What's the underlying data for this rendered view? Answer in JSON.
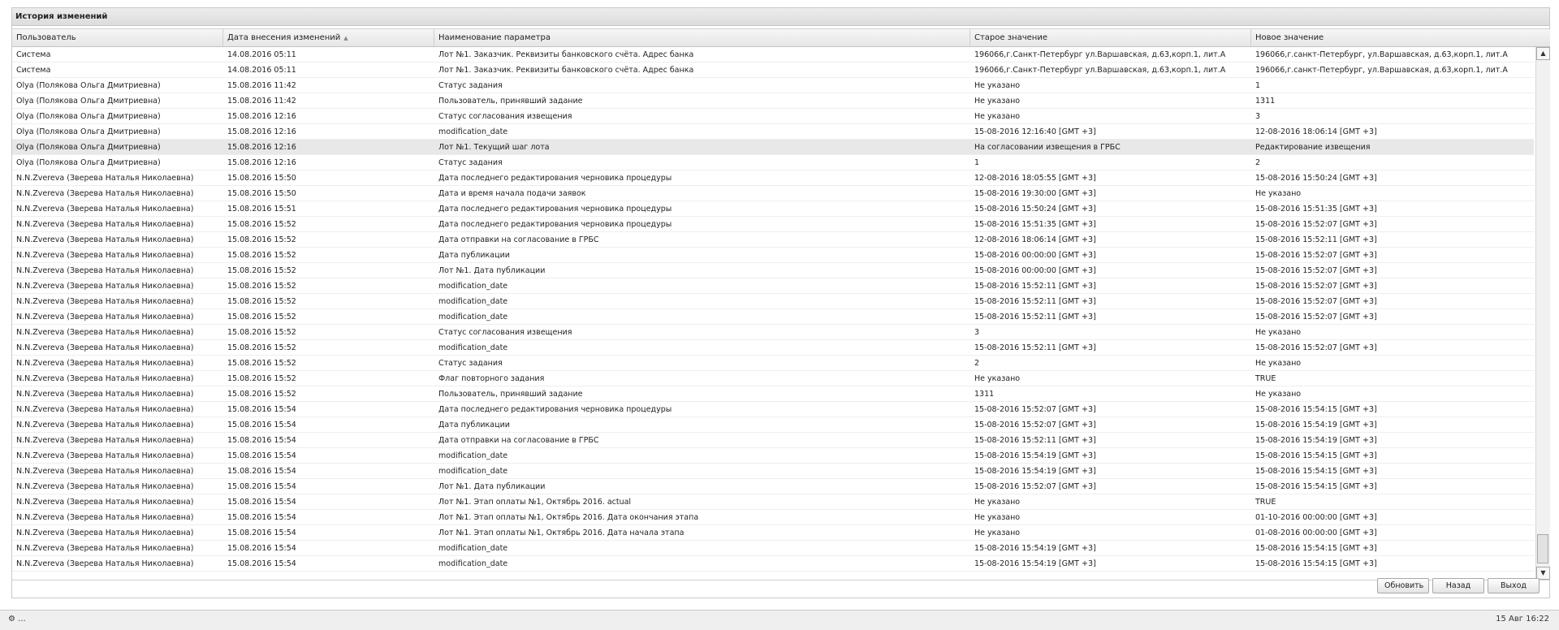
{
  "window": {
    "title": "История изменений"
  },
  "columns": [
    "Пользователь",
    "Дата внесения изменений",
    "Наименование параметра",
    "Старое значение",
    "Новое значение"
  ],
  "rows": [
    [
      "Система",
      "14.08.2016 05:11",
      "Лот №1. Заказчик. Реквизиты банковского счёта. Адрес банка",
      "196066,г.Санкт-Петербург ул.Варшавская, д.63,корп.1, лит.А",
      "196066,г.санкт-Петербург, ул.Варшавская, д.63,корп.1, лит.А"
    ],
    [
      "Система",
      "14.08.2016 05:11",
      "Лот №1. Заказчик. Реквизиты банковского счёта. Адрес банка",
      "196066,г.Санкт-Петербург ул.Варшавская, д.63,корп.1, лит.А",
      "196066,г.санкт-Петербург, ул.Варшавская, д.63,корп.1, лит.А"
    ],
    [
      "Olya (Полякова Ольга Дмитриевна)",
      "15.08.2016 11:42",
      "Статус задания",
      "Не указано",
      "1"
    ],
    [
      "Olya (Полякова Ольга Дмитриевна)",
      "15.08.2016 11:42",
      "Пользователь, принявший задание",
      "Не указано",
      "1311"
    ],
    [
      "Olya (Полякова Ольга Дмитриевна)",
      "15.08.2016 12:16",
      "Статус согласования извещения",
      "Не указано",
      "3"
    ],
    [
      "Olya (Полякова Ольга Дмитриевна)",
      "15.08.2016 12:16",
      "modification_date",
      "15-08-2016 12:16:40 [GMT +3]",
      "12-08-2016 18:06:14 [GMT +3]"
    ],
    [
      "Olya (Полякова Ольга Дмитриевна)",
      "15.08.2016 12:16",
      "Лот №1. Текущий шаг лота",
      "На согласовании извещения в ГРБС",
      "Редактирование извещения"
    ],
    [
      "Olya (Полякова Ольга Дмитриевна)",
      "15.08.2016 12:16",
      "Статус задания",
      "1",
      "2"
    ],
    [
      "N.N.Zvereva (Зверева Наталья Николаевна)",
      "15.08.2016 15:50",
      "Дата последнего редактирования черновика процедуры",
      "12-08-2016 18:05:55 [GMT +3]",
      "15-08-2016 15:50:24 [GMT +3]"
    ],
    [
      "N.N.Zvereva (Зверева Наталья Николаевна)",
      "15.08.2016 15:50",
      "Дата и время начала подачи заявок",
      "15-08-2016 19:30:00 [GMT +3]",
      "Не указано"
    ],
    [
      "N.N.Zvereva (Зверева Наталья Николаевна)",
      "15.08.2016 15:51",
      "Дата последнего редактирования черновика процедуры",
      "15-08-2016 15:50:24 [GMT +3]",
      "15-08-2016 15:51:35 [GMT +3]"
    ],
    [
      "N.N.Zvereva (Зверева Наталья Николаевна)",
      "15.08.2016 15:52",
      "Дата последнего редактирования черновика процедуры",
      "15-08-2016 15:51:35 [GMT +3]",
      "15-08-2016 15:52:07 [GMT +3]"
    ],
    [
      "N.N.Zvereva (Зверева Наталья Николаевна)",
      "15.08.2016 15:52",
      "Дата отправки на согласование в ГРБС",
      "12-08-2016 18:06:14 [GMT +3]",
      "15-08-2016 15:52:11 [GMT +3]"
    ],
    [
      "N.N.Zvereva (Зверева Наталья Николаевна)",
      "15.08.2016 15:52",
      "Дата публикации",
      "15-08-2016 00:00:00 [GMT +3]",
      "15-08-2016 15:52:07 [GMT +3]"
    ],
    [
      "N.N.Zvereva (Зверева Наталья Николаевна)",
      "15.08.2016 15:52",
      "Лот №1. Дата публикации",
      "15-08-2016 00:00:00 [GMT +3]",
      "15-08-2016 15:52:07 [GMT +3]"
    ],
    [
      "N.N.Zvereva (Зверева Наталья Николаевна)",
      "15.08.2016 15:52",
      "modification_date",
      "15-08-2016 15:52:11 [GMT +3]",
      "15-08-2016 15:52:07 [GMT +3]"
    ],
    [
      "N.N.Zvereva (Зверева Наталья Николаевна)",
      "15.08.2016 15:52",
      "modification_date",
      "15-08-2016 15:52:11 [GMT +3]",
      "15-08-2016 15:52:07 [GMT +3]"
    ],
    [
      "N.N.Zvereva (Зверева Наталья Николаевна)",
      "15.08.2016 15:52",
      "modification_date",
      "15-08-2016 15:52:11 [GMT +3]",
      "15-08-2016 15:52:07 [GMT +3]"
    ],
    [
      "N.N.Zvereva (Зверева Наталья Николаевна)",
      "15.08.2016 15:52",
      "Статус согласования извещения",
      "3",
      "Не указано"
    ],
    [
      "N.N.Zvereva (Зверева Наталья Николаевна)",
      "15.08.2016 15:52",
      "modification_date",
      "15-08-2016 15:52:11 [GMT +3]",
      "15-08-2016 15:52:07 [GMT +3]"
    ],
    [
      "N.N.Zvereva (Зверева Наталья Николаевна)",
      "15.08.2016 15:52",
      "Статус задания",
      "2",
      "Не указано"
    ],
    [
      "N.N.Zvereva (Зверева Наталья Николаевна)",
      "15.08.2016 15:52",
      "Флаг повторного задания",
      "Не указано",
      "TRUE"
    ],
    [
      "N.N.Zvereva (Зверева Наталья Николаевна)",
      "15.08.2016 15:52",
      "Пользователь, принявший задание",
      "1311",
      "Не указано"
    ],
    [
      "N.N.Zvereva (Зверева Наталья Николаевна)",
      "15.08.2016 15:54",
      "Дата последнего редактирования черновика процедуры",
      "15-08-2016 15:52:07 [GMT +3]",
      "15-08-2016 15:54:15 [GMT +3]"
    ],
    [
      "N.N.Zvereva (Зверева Наталья Николаевна)",
      "15.08.2016 15:54",
      "Дата публикации",
      "15-08-2016 15:52:07 [GMT +3]",
      "15-08-2016 15:54:19 [GMT +3]"
    ],
    [
      "N.N.Zvereva (Зверева Наталья Николаевна)",
      "15.08.2016 15:54",
      "Дата отправки на согласование в ГРБС",
      "15-08-2016 15:52:11 [GMT +3]",
      "15-08-2016 15:54:19 [GMT +3]"
    ],
    [
      "N.N.Zvereva (Зверева Наталья Николаевна)",
      "15.08.2016 15:54",
      "modification_date",
      "15-08-2016 15:54:19 [GMT +3]",
      "15-08-2016 15:54:15 [GMT +3]"
    ],
    [
      "N.N.Zvereva (Зверева Наталья Николаевна)",
      "15.08.2016 15:54",
      "modification_date",
      "15-08-2016 15:54:19 [GMT +3]",
      "15-08-2016 15:54:15 [GMT +3]"
    ],
    [
      "N.N.Zvereva (Зверева Наталья Николаевна)",
      "15.08.2016 15:54",
      "Лот №1. Дата публикации",
      "15-08-2016 15:52:07 [GMT +3]",
      "15-08-2016 15:54:15 [GMT +3]"
    ],
    [
      "N.N.Zvereva (Зверева Наталья Николаевна)",
      "15.08.2016 15:54",
      "Лот №1. Этап оплаты №1, Октябрь 2016. actual",
      "Не указано",
      "TRUE"
    ],
    [
      "N.N.Zvereva (Зверева Наталья Николаевна)",
      "15.08.2016 15:54",
      "Лот №1. Этап оплаты №1, Октябрь 2016. Дата окончания этапа",
      "Не указано",
      "01-10-2016 00:00:00 [GMT +3]"
    ],
    [
      "N.N.Zvereva (Зверева Наталья Николаевна)",
      "15.08.2016 15:54",
      "Лот №1. Этап оплаты №1, Октябрь 2016. Дата начала этапа",
      "Не указано",
      "01-08-2016 00:00:00 [GMT +3]"
    ],
    [
      "N.N.Zvereva (Зверева Наталья Николаевна)",
      "15.08.2016 15:54",
      "modification_date",
      "15-08-2016 15:54:19 [GMT +3]",
      "15-08-2016 15:54:15 [GMT +3]"
    ],
    [
      "N.N.Zvereva (Зверева Наталья Николаевна)",
      "15.08.2016 15:54",
      "modification_date",
      "15-08-2016 15:54:19 [GMT +3]",
      "15-08-2016 15:54:15 [GMT +3]"
    ]
  ],
  "selected_row_index": 6,
  "buttons": {
    "refresh": "Обновить",
    "back": "Назад",
    "exit": "Выход"
  },
  "status": {
    "left": "⚙ ...",
    "right": "15 Авг 16:22"
  },
  "icons": {
    "sort": "sort-ascending-icon",
    "scroll_up": "arrow-up-icon",
    "scroll_down": "arrow-down-icon"
  }
}
